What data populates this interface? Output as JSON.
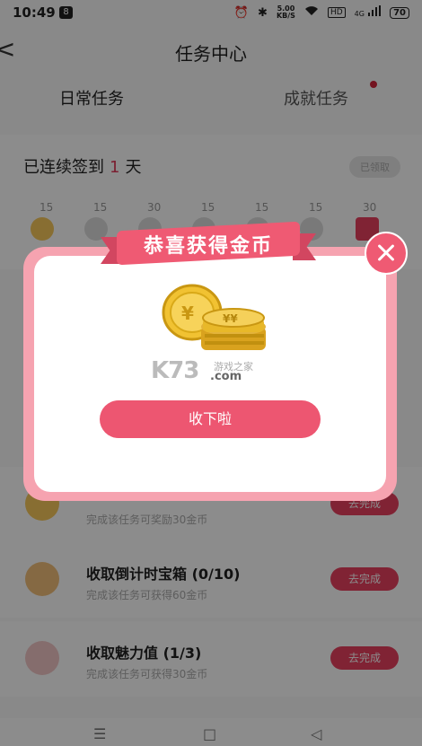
{
  "status_bar": {
    "time": "10:49",
    "notification_badge": "8",
    "net_speed_value": "5.00",
    "net_speed_unit": "KB/S",
    "hd": "HD",
    "signal": "4G",
    "battery": "70"
  },
  "header": {
    "title": "任务中心"
  },
  "tabs": [
    {
      "label": "日常任务"
    },
    {
      "label": "成就任务"
    }
  ],
  "signin": {
    "prefix": "已连续签到",
    "days": "1",
    "suffix": "天",
    "badge": "已领取",
    "rewards": [
      "15",
      "15",
      "30",
      "15",
      "15",
      "15",
      "30"
    ]
  },
  "tasks": [
    {
      "title": "",
      "subtitle": "完成该任务可奖励30金币",
      "button": "去完成"
    },
    {
      "title": "收取倒计时宝箱 (0/10)",
      "subtitle": "完成该任务可获得60金币",
      "button": "去完成"
    },
    {
      "title": "收取魅力值 (1/3)",
      "subtitle": "完成该任务可获得30金币",
      "button": "去完成"
    }
  ],
  "dialog": {
    "ribbon_title": "恭喜获得金币",
    "collect_button": "收下啦",
    "watermark_logo": "K73",
    "watermark_cn": "游戏之家",
    "watermark_com": ".com"
  },
  "navbar": {
    "menu": "☰",
    "home": "□",
    "back": "◁"
  },
  "colors": {
    "accent": "#ed5671",
    "dialog_border": "#f6a3b0",
    "ribbon": "#ef5a73"
  }
}
